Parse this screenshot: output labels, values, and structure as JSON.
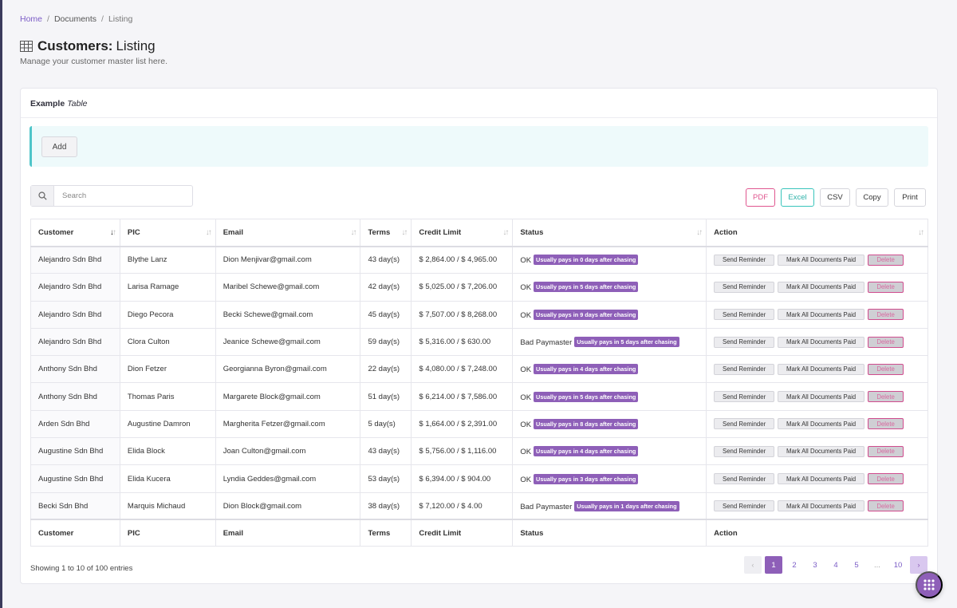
{
  "breadcrumb": {
    "home": "Home",
    "sep": "/",
    "documents": "Documents",
    "current": "Listing"
  },
  "page": {
    "title_bold": "Customers:",
    "title_light": "Listing",
    "subtitle": "Manage your customer master list here."
  },
  "card": {
    "title_bold": "Example",
    "title_italic": "Table"
  },
  "toolbar": {
    "add": "Add"
  },
  "search": {
    "placeholder": "Search",
    "value": ""
  },
  "exports": {
    "pdf": "PDF",
    "excel": "Excel",
    "csv": "CSV",
    "copy": "Copy",
    "print": "Print"
  },
  "columns": [
    "Customer",
    "PIC",
    "Email",
    "Terms",
    "Credit Limit",
    "Status",
    "Action"
  ],
  "actions": {
    "reminder": "Send Reminder",
    "mark": "Mark All Documents Paid",
    "delete": "Delete"
  },
  "rows": [
    {
      "customer": "Alejandro Sdn Bhd",
      "pic": "Blythe Lanz",
      "email": "Dion Menjivar@gmail.com",
      "terms": "43 day(s)",
      "credit": "$ 2,864.00 / $ 4,965.00",
      "status": "OK",
      "badge": "Usually pays in 0 days after chasing"
    },
    {
      "customer": "Alejandro Sdn Bhd",
      "pic": "Larisa Ramage",
      "email": "Maribel Schewe@gmail.com",
      "terms": "42 day(s)",
      "credit": "$ 5,025.00 / $ 7,206.00",
      "status": "OK",
      "badge": "Usually pays in 5 days after chasing"
    },
    {
      "customer": "Alejandro Sdn Bhd",
      "pic": "Diego Pecora",
      "email": "Becki Schewe@gmail.com",
      "terms": "45 day(s)",
      "credit": "$ 7,507.00 / $ 8,268.00",
      "status": "OK",
      "badge": "Usually pays in 9 days after chasing"
    },
    {
      "customer": "Alejandro Sdn Bhd",
      "pic": "Clora Culton",
      "email": "Jeanice Schewe@gmail.com",
      "terms": "59 day(s)",
      "credit": "$ 5,316.00 / $ 630.00",
      "status": "Bad Paymaster",
      "badge": "Usually pays in 5 days after chasing"
    },
    {
      "customer": "Anthony Sdn Bhd",
      "pic": "Dion Fetzer",
      "email": "Georgianna Byron@gmail.com",
      "terms": "22 day(s)",
      "credit": "$ 4,080.00 / $ 7,248.00",
      "status": "OK",
      "badge": "Usually pays in 4 days after chasing"
    },
    {
      "customer": "Anthony Sdn Bhd",
      "pic": "Thomas Paris",
      "email": "Margarete Block@gmail.com",
      "terms": "51 day(s)",
      "credit": "$ 6,214.00 / $ 7,586.00",
      "status": "OK",
      "badge": "Usually pays in 5 days after chasing"
    },
    {
      "customer": "Arden Sdn Bhd",
      "pic": "Augustine Damron",
      "email": "Margherita Fetzer@gmail.com",
      "terms": "5 day(s)",
      "credit": "$ 1,664.00 / $ 2,391.00",
      "status": "OK",
      "badge": "Usually pays in 8 days after chasing"
    },
    {
      "customer": "Augustine Sdn Bhd",
      "pic": "Elida Block",
      "email": "Joan Culton@gmail.com",
      "terms": "43 day(s)",
      "credit": "$ 5,756.00 / $ 1,116.00",
      "status": "OK",
      "badge": "Usually pays in 4 days after chasing"
    },
    {
      "customer": "Augustine Sdn Bhd",
      "pic": "Elida Kucera",
      "email": "Lyndia Geddes@gmail.com",
      "terms": "53 day(s)",
      "credit": "$ 6,394.00 / $ 904.00",
      "status": "OK",
      "badge": "Usually pays in 3 days after chasing"
    },
    {
      "customer": "Becki Sdn Bhd",
      "pic": "Marquis Michaud",
      "email": "Dion Block@gmail.com",
      "terms": "38 day(s)",
      "credit": "$ 7,120.00 / $ 4.00",
      "status": "Bad Paymaster",
      "badge": "Usually pays in 1 days after chasing"
    }
  ],
  "footer": {
    "info": "Showing 1 to 10 of 100 entries"
  },
  "pagination": {
    "prev": "‹",
    "pages": [
      "1",
      "2",
      "3",
      "4",
      "5"
    ],
    "ellipsis": "...",
    "last": "10",
    "next": "›",
    "current": "1"
  },
  "colors": {
    "accent": "#8e5fb8",
    "teal": "#4fc5c9",
    "pink": "#e0568f"
  },
  "icons": {
    "title": "table-grid-icon",
    "search": "search-icon",
    "fab": "apps-grid-icon"
  }
}
